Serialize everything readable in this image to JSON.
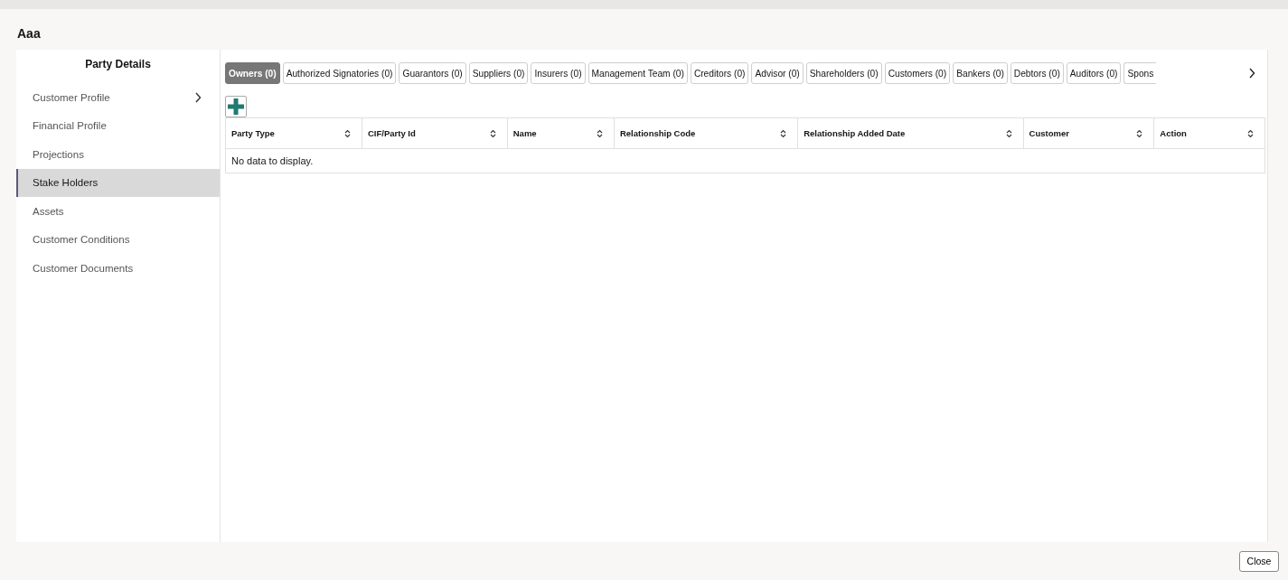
{
  "window": {
    "title": "Aaa"
  },
  "sidebar": {
    "title": "Party Details",
    "items": [
      {
        "label": "Customer Profile",
        "selected": false,
        "expandable": true
      },
      {
        "label": "Financial Profile",
        "selected": false,
        "expandable": false
      },
      {
        "label": "Projections",
        "selected": false,
        "expandable": false
      },
      {
        "label": "Stake Holders",
        "selected": true,
        "expandable": false
      },
      {
        "label": "Assets",
        "selected": false,
        "expandable": false
      },
      {
        "label": "Customer Conditions",
        "selected": false,
        "expandable": false
      },
      {
        "label": "Customer Documents",
        "selected": false,
        "expandable": false
      }
    ]
  },
  "tabs": [
    {
      "label": "Owners (0)",
      "selected": true
    },
    {
      "label": "Authorized Signatories (0)",
      "selected": false
    },
    {
      "label": "Guarantors (0)",
      "selected": false
    },
    {
      "label": "Suppliers (0)",
      "selected": false
    },
    {
      "label": "Insurers (0)",
      "selected": false
    },
    {
      "label": "Management Team (0)",
      "selected": false
    },
    {
      "label": "Creditors (0)",
      "selected": false
    },
    {
      "label": "Advisor (0)",
      "selected": false
    },
    {
      "label": "Shareholders (0)",
      "selected": false
    },
    {
      "label": "Customers (0)",
      "selected": false
    },
    {
      "label": "Bankers (0)",
      "selected": false
    },
    {
      "label": "Debtors (0)",
      "selected": false
    },
    {
      "label": "Auditors (0)",
      "selected": false
    },
    {
      "label": "Spons",
      "selected": false
    }
  ],
  "table": {
    "columns": [
      "Party Type",
      "CIF/Party Id",
      "Name",
      "Relationship Code",
      "Relationship Added Date",
      "Customer",
      "Action"
    ],
    "empty_message": "No data to display."
  },
  "buttons": [
    "Close"
  ]
}
